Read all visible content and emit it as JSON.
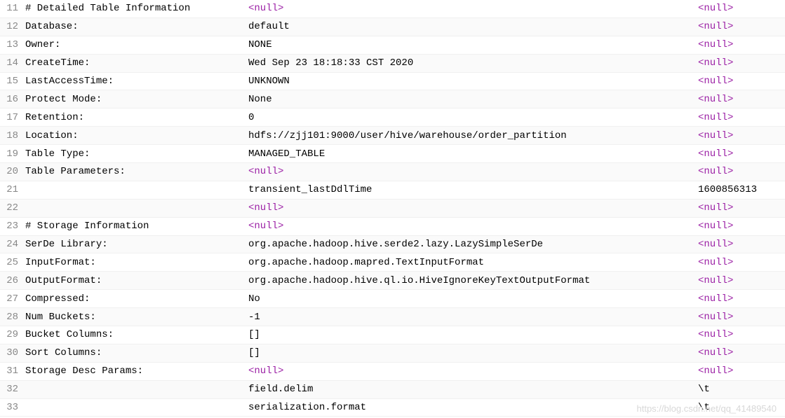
{
  "null_display": "<null>",
  "rows": [
    {
      "line": "11",
      "col1": "# Detailed Table Information",
      "col2": "<null>",
      "col2_null": true,
      "col3": "<null>",
      "col3_null": true
    },
    {
      "line": "12",
      "col1": "Database:",
      "col2": "default",
      "col2_null": false,
      "col3": "<null>",
      "col3_null": true
    },
    {
      "line": "13",
      "col1": "Owner:",
      "col2": "NONE",
      "col2_null": false,
      "col3": "<null>",
      "col3_null": true
    },
    {
      "line": "14",
      "col1": "CreateTime:",
      "col2": "Wed Sep 23 18:18:33 CST 2020",
      "col2_null": false,
      "col3": "<null>",
      "col3_null": true
    },
    {
      "line": "15",
      "col1": "LastAccessTime:",
      "col2": "UNKNOWN",
      "col2_null": false,
      "col3": "<null>",
      "col3_null": true
    },
    {
      "line": "16",
      "col1": "Protect Mode:",
      "col2": "None",
      "col2_null": false,
      "col3": "<null>",
      "col3_null": true
    },
    {
      "line": "17",
      "col1": "Retention:",
      "col2": "0",
      "col2_null": false,
      "col3": "<null>",
      "col3_null": true
    },
    {
      "line": "18",
      "col1": "Location:",
      "col2": "hdfs://zjj101:9000/user/hive/warehouse/order_partition",
      "col2_null": false,
      "col3": "<null>",
      "col3_null": true
    },
    {
      "line": "19",
      "col1": "Table Type:",
      "col2": "MANAGED_TABLE",
      "col2_null": false,
      "col3": "<null>",
      "col3_null": true
    },
    {
      "line": "20",
      "col1": "Table Parameters:",
      "col2": "<null>",
      "col2_null": true,
      "col3": "<null>",
      "col3_null": true
    },
    {
      "line": "21",
      "col1": "",
      "col2": "transient_lastDdlTime",
      "col2_null": false,
      "col3": "1600856313",
      "col3_null": false
    },
    {
      "line": "22",
      "col1": "",
      "col2": "<null>",
      "col2_null": true,
      "col3": "<null>",
      "col3_null": true
    },
    {
      "line": "23",
      "col1": "# Storage Information",
      "col2": "<null>",
      "col2_null": true,
      "col3": "<null>",
      "col3_null": true
    },
    {
      "line": "24",
      "col1": "SerDe Library:",
      "col2": "org.apache.hadoop.hive.serde2.lazy.LazySimpleSerDe",
      "col2_null": false,
      "col3": "<null>",
      "col3_null": true
    },
    {
      "line": "25",
      "col1": "InputFormat:",
      "col2": "org.apache.hadoop.mapred.TextInputFormat",
      "col2_null": false,
      "col3": "<null>",
      "col3_null": true
    },
    {
      "line": "26",
      "col1": "OutputFormat:",
      "col2": "org.apache.hadoop.hive.ql.io.HiveIgnoreKeyTextOutputFormat",
      "col2_null": false,
      "col3": "<null>",
      "col3_null": true
    },
    {
      "line": "27",
      "col1": "Compressed:",
      "col2": "No",
      "col2_null": false,
      "col3": "<null>",
      "col3_null": true
    },
    {
      "line": "28",
      "col1": "Num Buckets:",
      "col2": "-1",
      "col2_null": false,
      "col3": "<null>",
      "col3_null": true
    },
    {
      "line": "29",
      "col1": "Bucket Columns:",
      "col2": "[]",
      "col2_null": false,
      "col3": "<null>",
      "col3_null": true
    },
    {
      "line": "30",
      "col1": "Sort Columns:",
      "col2": "[]",
      "col2_null": false,
      "col3": "<null>",
      "col3_null": true
    },
    {
      "line": "31",
      "col1": "Storage Desc Params:",
      "col2": "<null>",
      "col2_null": true,
      "col3": "<null>",
      "col3_null": true
    },
    {
      "line": "32",
      "col1": "",
      "col2": "field.delim",
      "col2_null": false,
      "col3": "\\t",
      "col3_null": false
    },
    {
      "line": "33",
      "col1": "",
      "col2": "serialization.format",
      "col2_null": false,
      "col3": "\\t",
      "col3_null": false
    }
  ],
  "watermark": "https://blog.csdn.net/qq_41489540"
}
